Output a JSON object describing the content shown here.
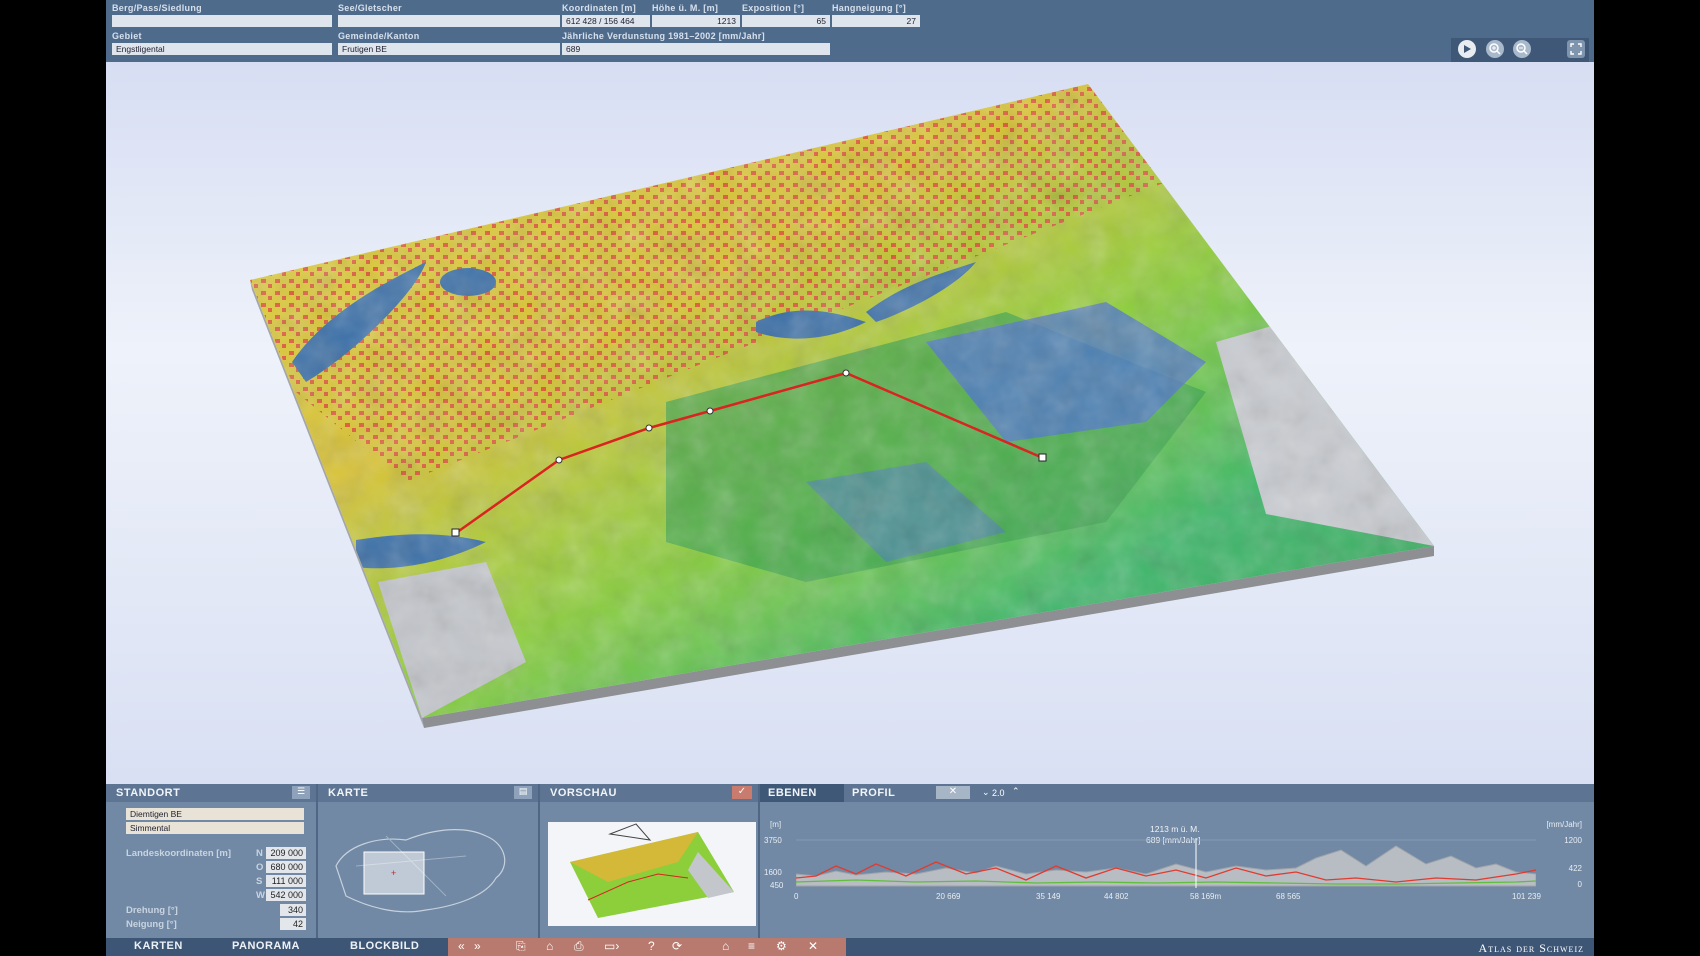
{
  "top": {
    "labels": {
      "berg": "Berg/Pass/Siedlung",
      "see": "See/Gletscher",
      "koordinaten": "Koordinaten [m]",
      "hoehe": "Höhe ü. M. [m]",
      "exposition": "Exposition [°]",
      "hangneigung": "Hangneigung [°]",
      "gebiet": "Gebiet",
      "gemeinde": "Gemeinde/Kanton",
      "verdunstung": "Jährliche Verdunstung 1981–2002 [mm/Jahr]"
    },
    "values": {
      "berg": "",
      "see": "",
      "koordinaten": "612 428 / 156 464",
      "hoehe": "1213",
      "exposition": "65",
      "hangneigung": "27",
      "gebiet": "Engstligental",
      "gemeinde": "Frutigen   BE",
      "verdunstung": "689"
    },
    "tools": [
      "play-icon",
      "zoom-in-icon",
      "zoom-out-icon",
      "fullscreen-icon"
    ]
  },
  "standort": {
    "title": "STANDORT",
    "field1": "Diemtigen   BE",
    "field2": "Simmental",
    "landeskoordinaten_label": "Landeskoordinaten [m]",
    "coords": [
      {
        "dir": "N",
        "value": "209 000"
      },
      {
        "dir": "O",
        "value": "680 000"
      },
      {
        "dir": "S",
        "value": "111 000"
      },
      {
        "dir": "W",
        "value": "542 000"
      }
    ],
    "drehung_label": "Drehung [°]",
    "drehung": "340",
    "neigung_label": "Neigung [°]",
    "neigung": "42"
  },
  "karte": {
    "title": "KARTE"
  },
  "vorschau": {
    "title": "VORSCHAU"
  },
  "ebenen": {
    "tab_ebenen": "EBENEN",
    "tab_profil": "PROFIL",
    "scale": "2.0",
    "unit_left": "[m]",
    "unit_right": "[mm/Jahr]",
    "marker_line1": "1213 m ü. M.",
    "marker_line2": "689 [mm/Jahr]",
    "y_left": [
      "3750",
      "1600",
      "450"
    ],
    "y_right": [
      "1200",
      "422",
      "0"
    ],
    "x_ticks": [
      "0",
      "20 669",
      "35 149",
      "44 802",
      "58 169m",
      "68 565",
      "101 239"
    ]
  },
  "bottom": {
    "tabs": [
      "KARTEN",
      "PANORAMA",
      "BLOCKBILD"
    ],
    "brand": "Atlas der Schweiz"
  },
  "colors": {
    "panel": "#7189a4",
    "topbar": "#4f6b8c",
    "profile_red": "#e03b2f",
    "profile_green": "#5fbf3c",
    "profile_gray": "#a9adb4"
  }
}
